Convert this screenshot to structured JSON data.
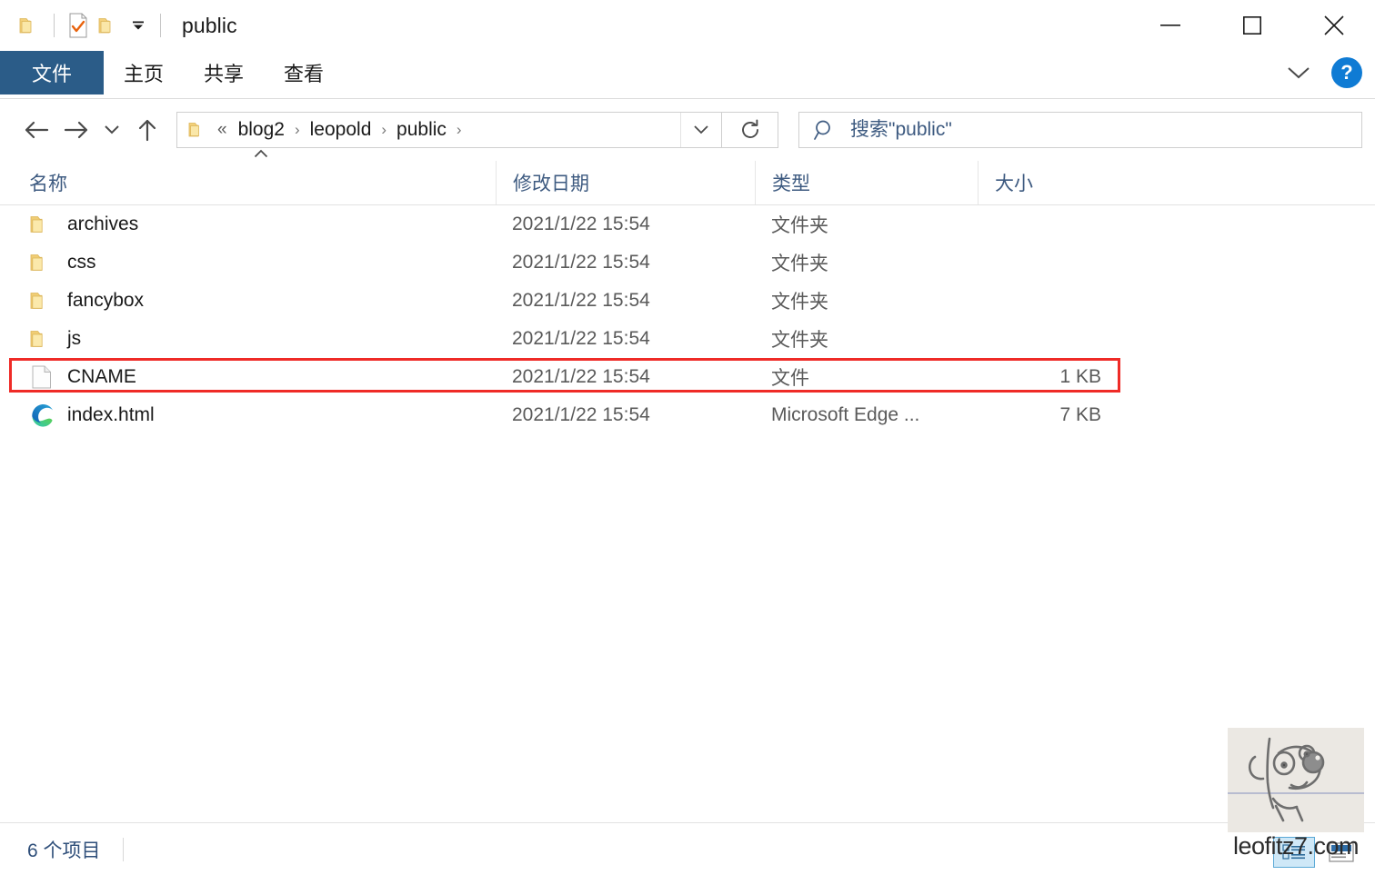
{
  "window": {
    "title": "public",
    "quick_access": [
      {
        "name": "folder-icon",
        "label": "文件资源管理器"
      },
      {
        "name": "properties-icon",
        "label": "属性"
      },
      {
        "name": "new-folder-icon",
        "label": "新建文件夹"
      }
    ],
    "controls": {
      "minimize": "—",
      "maximize": "▢",
      "close": "✕"
    }
  },
  "ribbon": {
    "tabs": [
      {
        "label": "文件",
        "active": true
      },
      {
        "label": "主页",
        "active": false
      },
      {
        "label": "共享",
        "active": false
      },
      {
        "label": "查看",
        "active": false
      }
    ],
    "expand_label": "展开功能区",
    "help_label": "?"
  },
  "navbar": {
    "back_label": "后退",
    "forward_label": "前进",
    "recent_label": "最近浏览的位置",
    "up_label": "上一级",
    "breadcrumb_prefix": "«",
    "breadcrumb": [
      "blog2",
      "leopold",
      "public"
    ],
    "breadcrumb_separator": "›",
    "refresh_label": "刷新",
    "search_placeholder": "搜索\"public\"",
    "search_value": ""
  },
  "columns": [
    {
      "key": "name",
      "label": "名称",
      "sorted": "asc"
    },
    {
      "key": "date",
      "label": "修改日期",
      "sorted": ""
    },
    {
      "key": "type",
      "label": "类型",
      "sorted": ""
    },
    {
      "key": "size",
      "label": "大小",
      "sorted": ""
    }
  ],
  "files": [
    {
      "name": "archives",
      "date": "2021/1/22 15:54",
      "type": "文件夹",
      "size": "",
      "icon": "folder-icon",
      "highlighted": false
    },
    {
      "name": "css",
      "date": "2021/1/22 15:54",
      "type": "文件夹",
      "size": "",
      "icon": "folder-icon",
      "highlighted": false
    },
    {
      "name": "fancybox",
      "date": "2021/1/22 15:54",
      "type": "文件夹",
      "size": "",
      "icon": "folder-icon",
      "highlighted": false
    },
    {
      "name": "js",
      "date": "2021/1/22 15:54",
      "type": "文件夹",
      "size": "",
      "icon": "folder-icon",
      "highlighted": false
    },
    {
      "name": "CNAME",
      "date": "2021/1/22 15:54",
      "type": "文件",
      "size": "1 KB",
      "icon": "file-icon",
      "highlighted": true
    },
    {
      "name": "index.html",
      "date": "2021/1/22 15:54",
      "type": "Microsoft Edge ...",
      "size": "7 KB",
      "icon": "edge-icon",
      "highlighted": false
    }
  ],
  "status": {
    "item_count": "6 个项目",
    "view_details_label": "详细信息",
    "view_large_icons_label": "大图标"
  },
  "watermark": {
    "text": "leofitz7.com"
  },
  "colors": {
    "accent_tab": "#2b5c88",
    "annotation": "#ef2b27",
    "header_text": "#3d5a80",
    "help_button": "#0f7bd4",
    "folder": "#f6d97c"
  }
}
